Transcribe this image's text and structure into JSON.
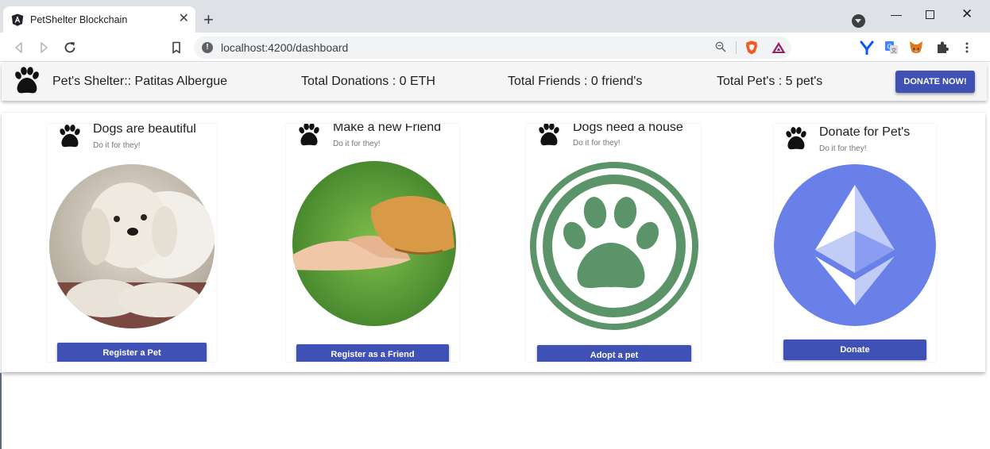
{
  "browser": {
    "tab_title": "PetShelter Blockchain",
    "tab_close": "✕",
    "new_tab": "+",
    "url": "localhost:4200/dashboard",
    "info_glyph": "!",
    "window_minimize": "—",
    "window_close": "✕"
  },
  "header": {
    "title": "Pet's Shelter:: Patitas Albergue",
    "total_donations": "Total Donations : 0 ETH",
    "total_friends": "Total Friends : 0 friend's",
    "total_pets": "Total Pet's : 5 pet's",
    "donate_button": "DONATE NOW!"
  },
  "cards": [
    {
      "title": "Dogs are beautiful",
      "subtitle": "Do it for they!",
      "button": "Register a Pet",
      "image": "dog-photo"
    },
    {
      "title": "Make a new Friend",
      "subtitle": "Do it for they!",
      "button": "Register as a Friend",
      "image": "hand-and-paw-photo"
    },
    {
      "title": "Dogs need a house",
      "subtitle": "Do it for they!",
      "button": "Adopt a pet",
      "image": "green-paw-emblem"
    },
    {
      "title": "Donate for Pet's",
      "subtitle": "Do it for they!",
      "button": "Donate",
      "image": "ethereum-logo"
    }
  ],
  "colors": {
    "primary": "#3f51b5",
    "paw_green": "#5a9468",
    "ethereum_blue": "#6880e8"
  },
  "icons": {
    "paw": "paw-icon",
    "extensions": [
      "yearn-icon",
      "translate-icon",
      "metamask-fox-icon",
      "puzzle-extensions-icon",
      "menu-icon"
    ]
  }
}
